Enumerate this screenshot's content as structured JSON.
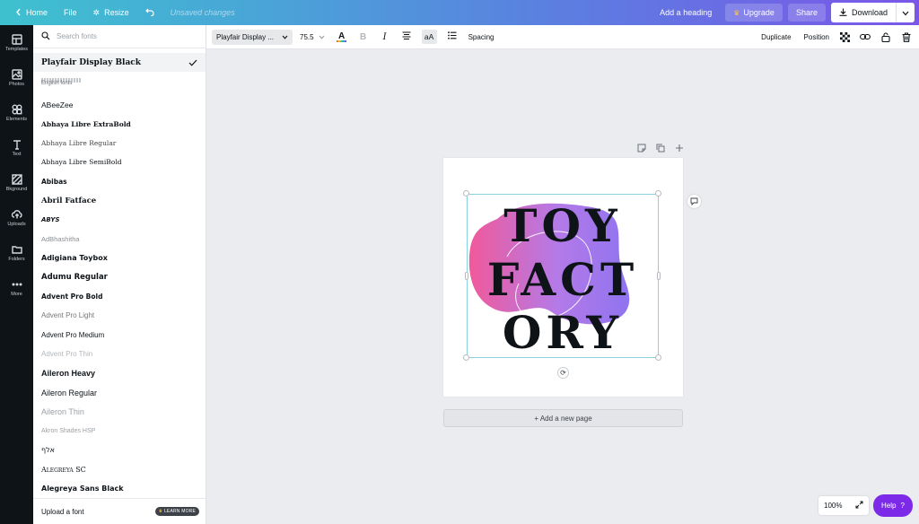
{
  "topbar": {
    "home": "Home",
    "file": "File",
    "resize": "Resize",
    "status": "Unsaved changes",
    "add_heading": "Add a heading",
    "upgrade": "Upgrade",
    "share": "Share",
    "download": "Download"
  },
  "rail": [
    {
      "label": "Templates",
      "icon": "templates-icon"
    },
    {
      "label": "Photos",
      "icon": "photos-icon"
    },
    {
      "label": "Elements",
      "icon": "elements-icon"
    },
    {
      "label": "Text",
      "icon": "text-icon"
    },
    {
      "label": "Bkground",
      "icon": "background-icon"
    },
    {
      "label": "Uploads",
      "icon": "uploads-icon"
    },
    {
      "label": "Folders",
      "icon": "folders-icon"
    },
    {
      "label": "More",
      "icon": "more-icon"
    }
  ],
  "font_panel": {
    "search_placeholder": "Search fonts",
    "selected_font": "Playfair Display Black",
    "section_label": "English fonts",
    "fonts": [
      "ABeeZee",
      "Abhaya Libre ExtraBold",
      "Abhaya Libre Regular",
      "Abhaya Libre SemiBold",
      "Abibas",
      "Abril Fatface",
      "ABYS",
      "AdBhashitha",
      "Adigiana Toybox",
      "Adumu Regular",
      "Advent Pro Bold",
      "Advent Pro Light",
      "Advent Pro Medium",
      "Advent Pro Thin",
      "Aileron Heavy",
      "Aileron Regular",
      "Aileron Thin",
      "Akron Shades HSP",
      "אלף",
      "Alegreya SC",
      "Alegreya Sans Black"
    ],
    "upload_font": "Upload a font",
    "learn_more": "LEARN MORE"
  },
  "toolbar": {
    "font_name": "Playfair Display ...",
    "font_size": "75.5",
    "spacing": "Spacing",
    "duplicate": "Duplicate",
    "position": "Position",
    "text_color": "#0e1318"
  },
  "canvas": {
    "text_lines": [
      "TOY",
      "FACT",
      "ORY"
    ],
    "blob_gradient": [
      "#f05a9a",
      "#b47ae8",
      "#8f74f0"
    ],
    "add_page": "+ Add a new page"
  },
  "footer": {
    "zoom": "100%",
    "help": "Help",
    "help_icon": "?"
  }
}
